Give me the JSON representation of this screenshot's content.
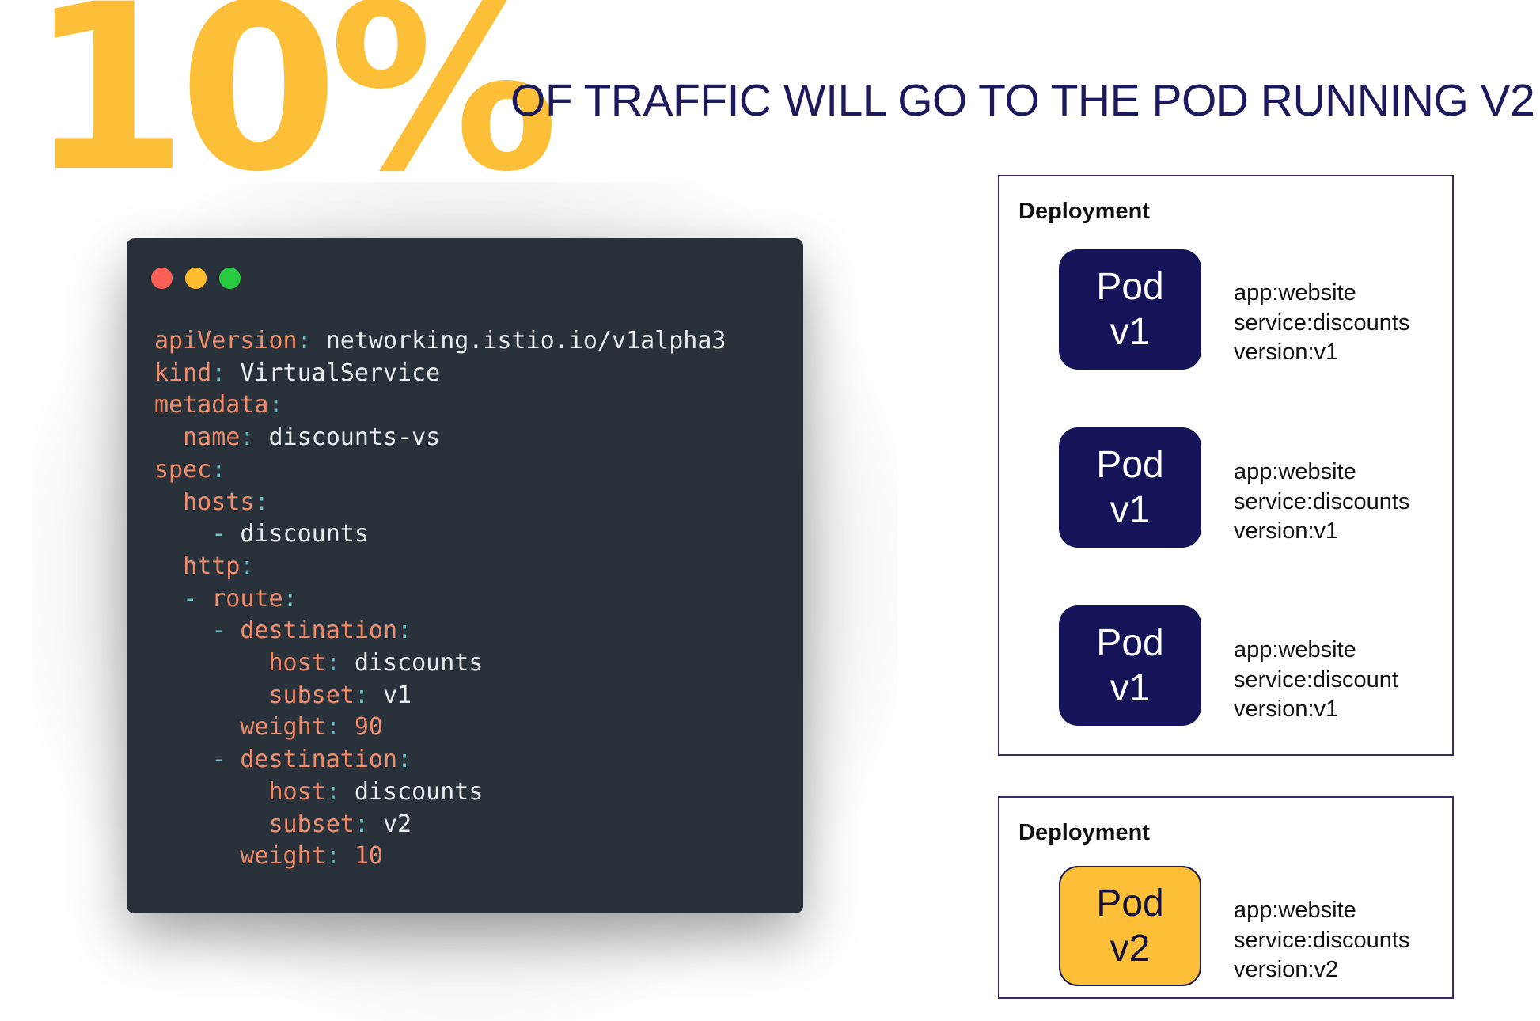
{
  "headline": {
    "percent": "10%",
    "text": "OF TRAFFIC WILL GO TO THE POD RUNNING V2"
  },
  "colors": {
    "accent_yellow": "#fcbf37",
    "navy": "#151459",
    "editor_bg": "#29323a",
    "key_color": "#ee8c6c",
    "punct_color": "#6ec2c6"
  },
  "editor": {
    "window_buttons": [
      "close",
      "minimize",
      "maximize"
    ],
    "code": [
      {
        "indent": "",
        "dash": "",
        "key": "apiVersion",
        "value": "networking.istio.io/v1alpha3"
      },
      {
        "indent": "",
        "dash": "",
        "key": "kind",
        "value": "VirtualService"
      },
      {
        "indent": "",
        "dash": "",
        "key": "metadata",
        "value": ""
      },
      {
        "indent": "  ",
        "dash": "",
        "key": "name",
        "value": "discounts-vs"
      },
      {
        "indent": "",
        "dash": "",
        "key": "spec",
        "value": ""
      },
      {
        "indent": "  ",
        "dash": "",
        "key": "hosts",
        "value": ""
      },
      {
        "indent": "    ",
        "dash": "- ",
        "key": "",
        "value": "discounts"
      },
      {
        "indent": "  ",
        "dash": "",
        "key": "http",
        "value": ""
      },
      {
        "indent": "  ",
        "dash": "- ",
        "key": "route",
        "value": ""
      },
      {
        "indent": "    ",
        "dash": "- ",
        "key": "destination",
        "value": ""
      },
      {
        "indent": "        ",
        "dash": "",
        "key": "host",
        "value": "discounts"
      },
      {
        "indent": "        ",
        "dash": "",
        "key": "subset",
        "value": "v1"
      },
      {
        "indent": "      ",
        "dash": "",
        "key": "weight",
        "value": "90",
        "numeric": true
      },
      {
        "indent": "    ",
        "dash": "- ",
        "key": "destination",
        "value": ""
      },
      {
        "indent": "        ",
        "dash": "",
        "key": "host",
        "value": "discounts"
      },
      {
        "indent": "        ",
        "dash": "",
        "key": "subset",
        "value": "v2"
      },
      {
        "indent": "      ",
        "dash": "",
        "key": "weight",
        "value": "10",
        "numeric": true
      }
    ]
  },
  "deployments": [
    {
      "title": "Deployment",
      "pods": [
        {
          "name": "Pod",
          "version": "v1",
          "labels": [
            "app:website",
            "service:discounts",
            "version:v1"
          ]
        },
        {
          "name": "Pod",
          "version": "v1",
          "labels": [
            "app:website",
            "service:discounts",
            "version:v1"
          ]
        },
        {
          "name": "Pod",
          "version": "v1",
          "labels": [
            "app:website",
            "service:discount",
            "version:v1"
          ]
        }
      ]
    },
    {
      "title": "Deployment",
      "pods": [
        {
          "name": "Pod",
          "version": "v2",
          "labels": [
            "app:website",
            "service:discounts",
            "version:v2"
          ]
        }
      ]
    }
  ]
}
